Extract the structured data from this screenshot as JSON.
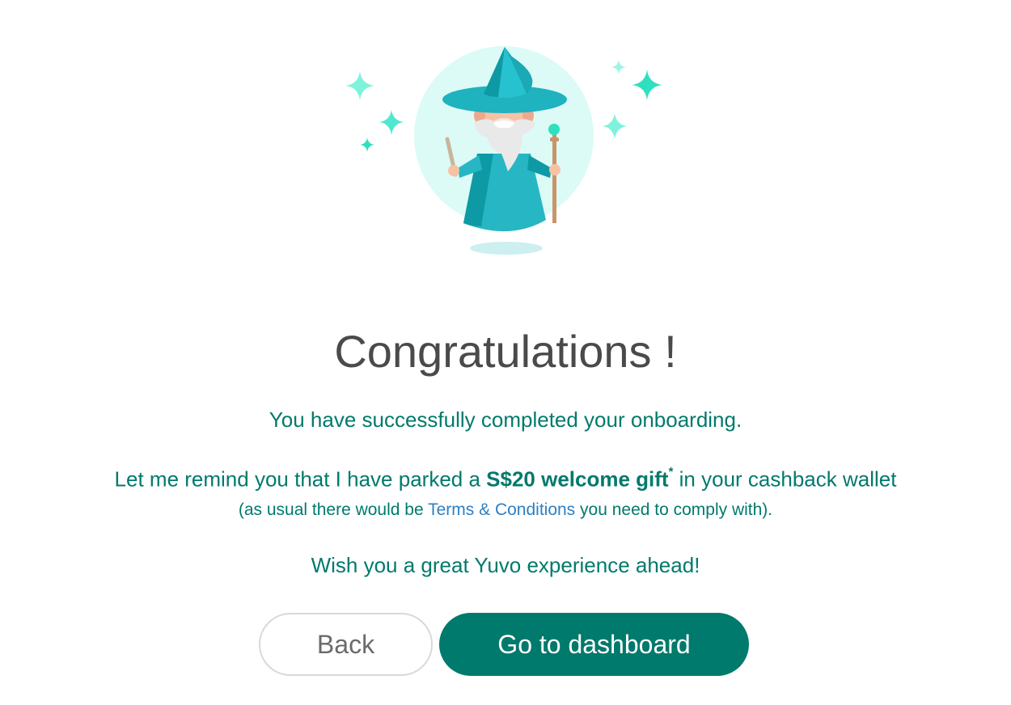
{
  "illustration": {
    "icon": "wizard-illustration",
    "colors": {
      "circle": "#dcfbf6",
      "robe": "#27b6c4",
      "robe_dark": "#0e9aa4",
      "sparkle": "#2fe0c0",
      "sparkle_light": "#7ff2dc"
    }
  },
  "title": "Congratulations !",
  "message": {
    "line1": "You have successfully completed your onboarding.",
    "line2_prefix": "Let me remind you that I have parked a ",
    "line2_bold": "S$20 welcome gift",
    "line2_sup": "*",
    "line2_suffix": " in your cashback wallet",
    "line3_prefix": "(as usual there would be ",
    "line3_link": "Terms & Conditions",
    "line3_suffix": " you need to comply with).",
    "line4": "Wish you a great Yuvo experience ahead!"
  },
  "buttons": {
    "back_label": "Back",
    "dashboard_label": "Go to dashboard"
  },
  "colors": {
    "accent": "#007a6c",
    "title": "#4a4a4a",
    "link": "#2f7fc1"
  }
}
